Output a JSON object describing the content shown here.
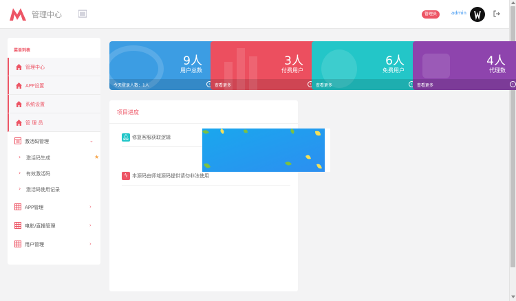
{
  "header": {
    "title": "管理中心",
    "role_badge": "管理员",
    "username": "admin",
    "brand_color": "#ed5565"
  },
  "sidebar": {
    "heading": "菜单列表",
    "main_items": [
      {
        "label": "管理中心",
        "icon": "home-icon"
      },
      {
        "label": "APP设置",
        "icon": "home-icon"
      },
      {
        "label": "系统设置",
        "icon": "home-icon"
      },
      {
        "label": "管 理 员",
        "icon": "home-icon"
      }
    ],
    "groups": [
      {
        "label": "激活码管理",
        "icon": "table-icon",
        "expanded": true,
        "children": [
          "激活码生成",
          "有效激活码",
          "激活码使用记录"
        ]
      },
      {
        "label": "APP管理",
        "icon": "grid-icon"
      },
      {
        "label": "电影/直播管理",
        "icon": "grid-icon"
      },
      {
        "label": "用户管理",
        "icon": "grid-icon"
      }
    ]
  },
  "cards": [
    {
      "number": "9人",
      "label": "用户总数",
      "footer": "今天登录人数：1人",
      "color": "#3c9de3"
    },
    {
      "number": "3人",
      "label": "付费用户",
      "footer": "查看更多",
      "color": "#ec4f5f"
    },
    {
      "number": "6人",
      "label": "免费用户",
      "footer": "查看更多",
      "color": "#23c6c8"
    },
    {
      "number": "4人",
      "label": "代理数",
      "footer": "查看更多",
      "color": "#8e44ad"
    }
  ],
  "progress": {
    "title": "项目进度",
    "items": [
      {
        "text": "修复客服获取逻辑",
        "icon": "bell-icon",
        "color": "#23c6c8"
      },
      {
        "text": "本源码由师域源码提供请勿非法使用",
        "icon": "bolt-icon",
        "color": "#ed5565"
      }
    ]
  }
}
